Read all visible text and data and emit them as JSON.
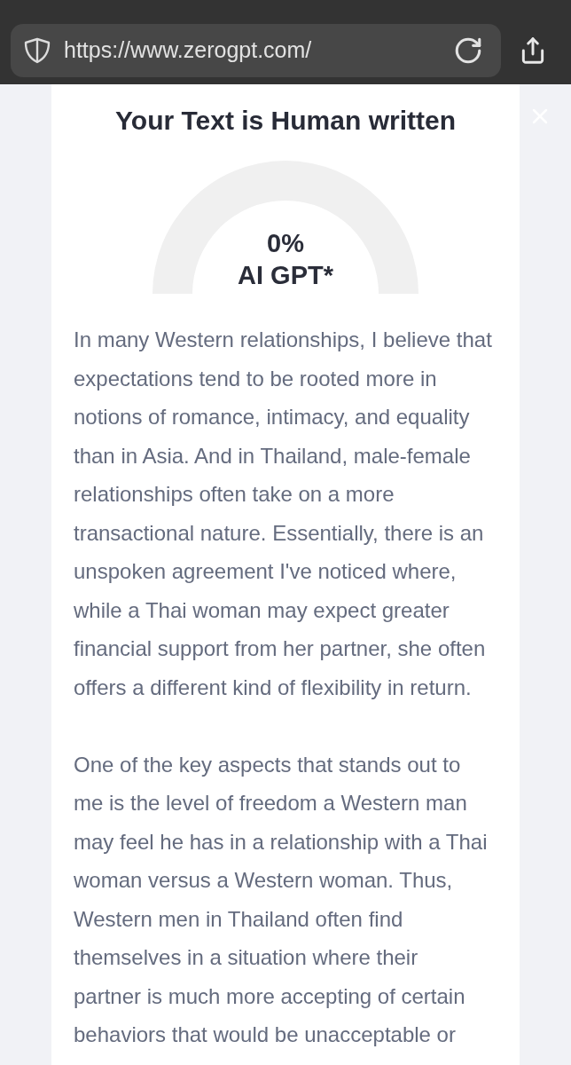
{
  "browser": {
    "url": "https://www.zerogpt.com/"
  },
  "result": {
    "title": "Your Text is Human written",
    "gauge": {
      "value": "0%",
      "label": "AI GPT*"
    }
  },
  "paragraphs": [
    {
      "lines": [
        "In many Western relationships, I believe that",
        "expectations tend to be rooted more in",
        "notions of romance, intimacy, and equality",
        "than in Asia. And in Thailand, male-female",
        "relationships often take on a more",
        "transactional nature. Essentially, there is an",
        "unspoken agreement I've noticed where,",
        "while a Thai woman may expect greater",
        "financial support from her partner, she often",
        "offers a different kind of flexibility in return."
      ]
    },
    {
      "lines": [
        "One of the key aspects that stands out to",
        "me is the level of freedom a Western man",
        "may feel he has in a relationship with a Thai",
        "woman versus a Western woman. Thus,",
        "Western men in Thailand often find",
        "themselves in a situation where their",
        "partner is much more accepting of certain",
        "behaviors that would be unacceptable or"
      ]
    }
  ]
}
